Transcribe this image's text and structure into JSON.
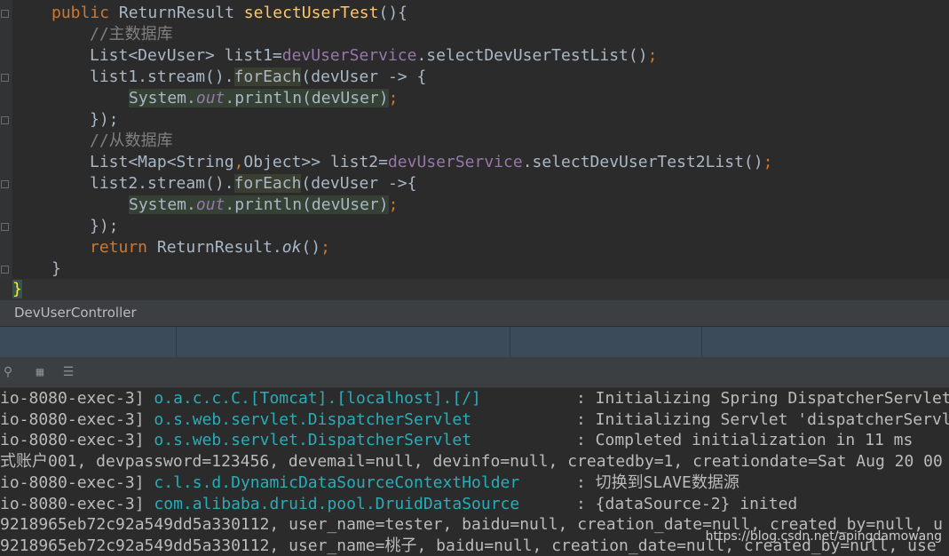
{
  "editor": {
    "method_decl": {
      "kw": "public",
      "type": "ReturnResult",
      "name": "selectUserTest",
      "rest": "(){"
    },
    "comment_main": "//主数据库",
    "line_list1": {
      "decl": "List<DevUser> list1=",
      "field": "devUserService",
      "call": ".selectDevUserTestList()",
      "semi": ";"
    },
    "line_stream1": {
      "pre": "list1.stream().",
      "method": "forEach",
      "args": "(devUser -> {"
    },
    "line_print1": {
      "cls": "System.",
      "out": "out",
      "call": ".println(devUser)",
      "semi": ";"
    },
    "close_lambda": "});",
    "comment_slave": "//从数据库",
    "line_list2": {
      "decl_a": "List<Map<String",
      "comma": ",",
      "decl_b": "Object>> list2=",
      "field": "devUserService",
      "call": ".selectDevUserTest2List()",
      "semi": ";"
    },
    "line_stream2": {
      "pre": "list2.stream().",
      "method": "forEach",
      "args": "(devUser ->{"
    },
    "line_print2": {
      "cls": "System.",
      "out": "out",
      "call": ".println(devUser)",
      "semi": ";"
    },
    "close_lambda2": "});",
    "return_line": {
      "kw": "return",
      "cls": " ReturnResult.",
      "method": "ok",
      "rest": "()",
      "semi": ";"
    },
    "close_method": "}",
    "close_class": "}"
  },
  "file_tab": "DevUserController",
  "console": {
    "lines": [
      {
        "thread": "io-8080-exec-3]",
        "cls": "o.a.c.c.C.[Tomcat].[localhost].[/]",
        "msg": ": Initializing Spring DispatcherServlet"
      },
      {
        "thread": "io-8080-exec-3]",
        "cls": "o.s.web.servlet.DispatcherServlet",
        "msg": ": Initializing Servlet 'dispatcherServlet'"
      },
      {
        "thread": "io-8080-exec-3]",
        "cls": "o.s.web.servlet.DispatcherServlet",
        "msg": ": Completed initialization in 11 ms"
      },
      {
        "text": "式账户001, devpassword=123456, devemail=null, devinfo=null, createdby=1, creationdate=Sat Aug 20 00"
      },
      {
        "thread": "io-8080-exec-3]",
        "cls": "c.l.s.d.DynamicDataSourceContextHolder",
        "msg": ": 切换到SLAVE数据源"
      },
      {
        "thread": "io-8080-exec-3]",
        "cls": "com.alibaba.druid.pool.DruidDataSource",
        "msg": ": {dataSource-2} inited"
      },
      {
        "text": "9218965eb72c92a549dd5a330112, user_name=tester, baidu=null, creation_date=null, created_by=null, u"
      },
      {
        "text": "9218965eb72c92a549dd5a330112, user_name=桃子, baidu=null, creation_date=null, created_by=null, use"
      }
    ]
  },
  "watermark": "https://blog.csdn.net/apingdamowang"
}
